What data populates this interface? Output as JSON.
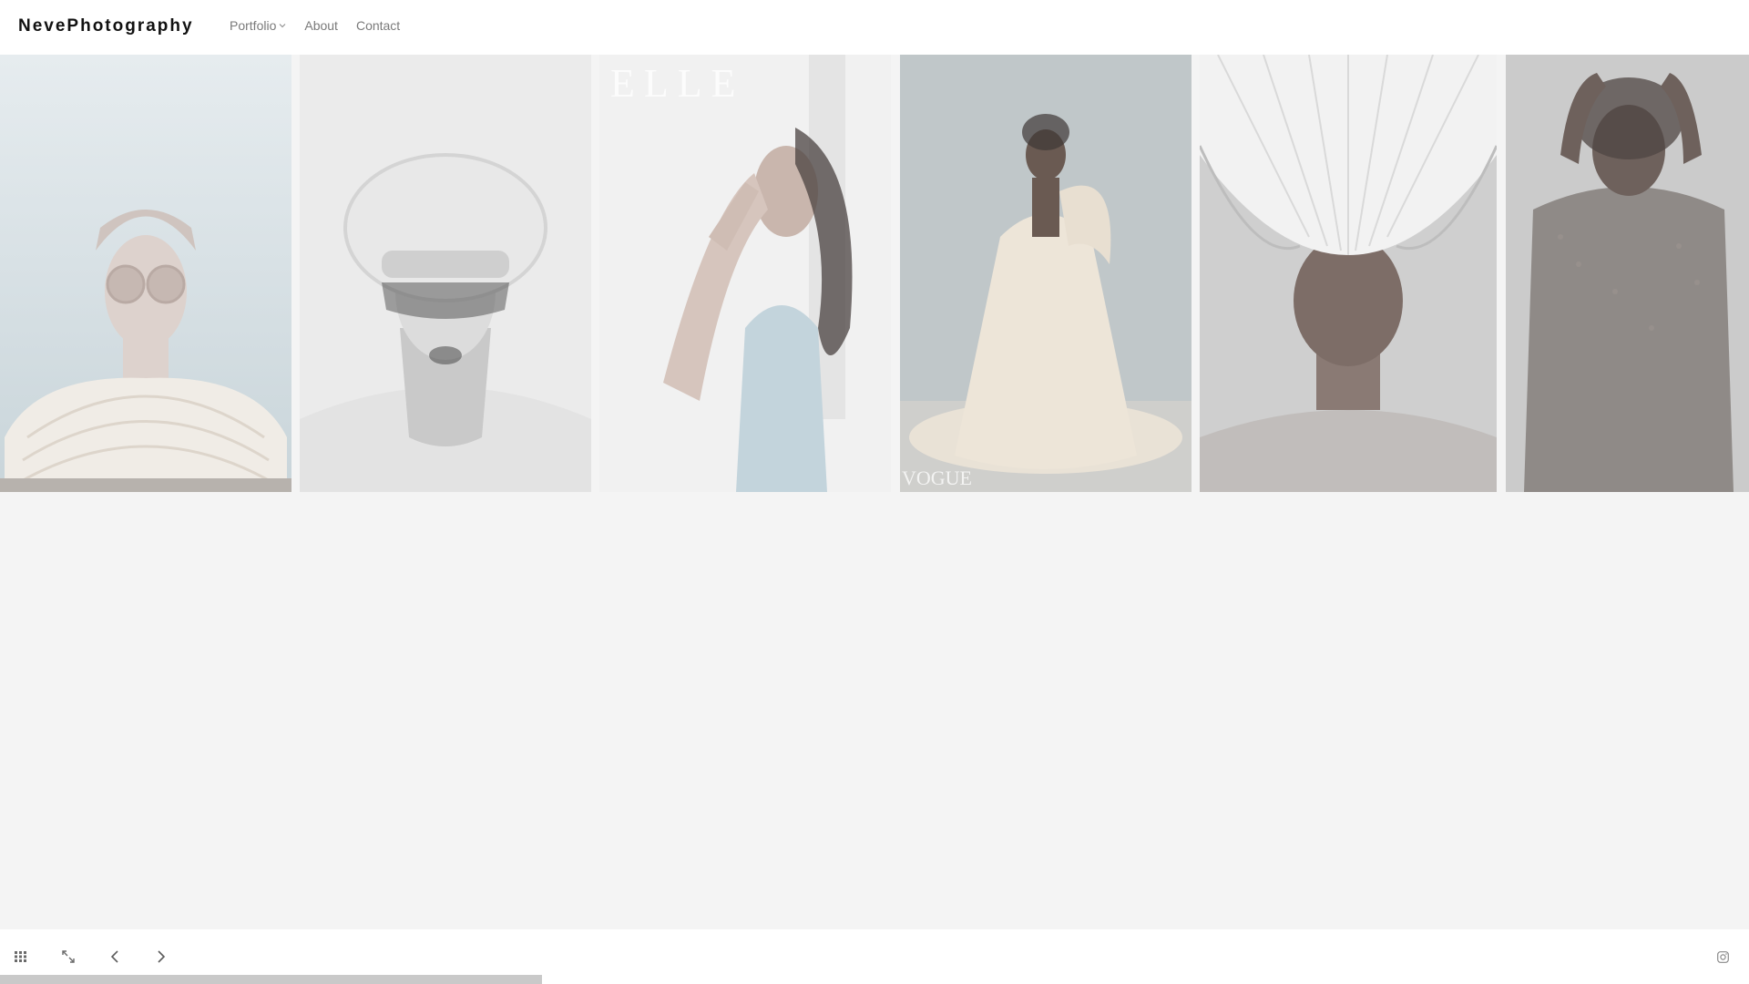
{
  "header": {
    "brand": "NevePhotography",
    "nav": [
      {
        "label": "Portfolio",
        "has_dropdown": true
      },
      {
        "label": "About",
        "has_dropdown": false
      },
      {
        "label": "Contact",
        "has_dropdown": false
      }
    ]
  },
  "gallery": {
    "panels": [
      {
        "subject": "model with round sunglasses and pearl collar",
        "overlay": ""
      },
      {
        "subject": "model with crystal cap and sunglasses",
        "overlay": ""
      },
      {
        "subject": "model in blue top with ELLE masthead",
        "overlay": "ELLE"
      },
      {
        "subject": "model in ruffled gown with VOGUE masthead",
        "overlay": "VOGUE"
      },
      {
        "subject": "model with pleated white headpiece",
        "overlay": ""
      },
      {
        "subject": "model with hands raised in embellished top",
        "overlay": ""
      }
    ]
  },
  "footer": {
    "icons": [
      "grid-icon",
      "fullscreen-icon",
      "prev-arrow-icon",
      "next-arrow-icon",
      "instagram-icon"
    ]
  },
  "scroll": {
    "progress_fraction": 0.31
  },
  "colors": {
    "background": "#f4f4f4",
    "header": "#ffffff",
    "brand_text": "#111111",
    "nav_text": "#7a7a7a",
    "progress": "#c9c9c9"
  }
}
